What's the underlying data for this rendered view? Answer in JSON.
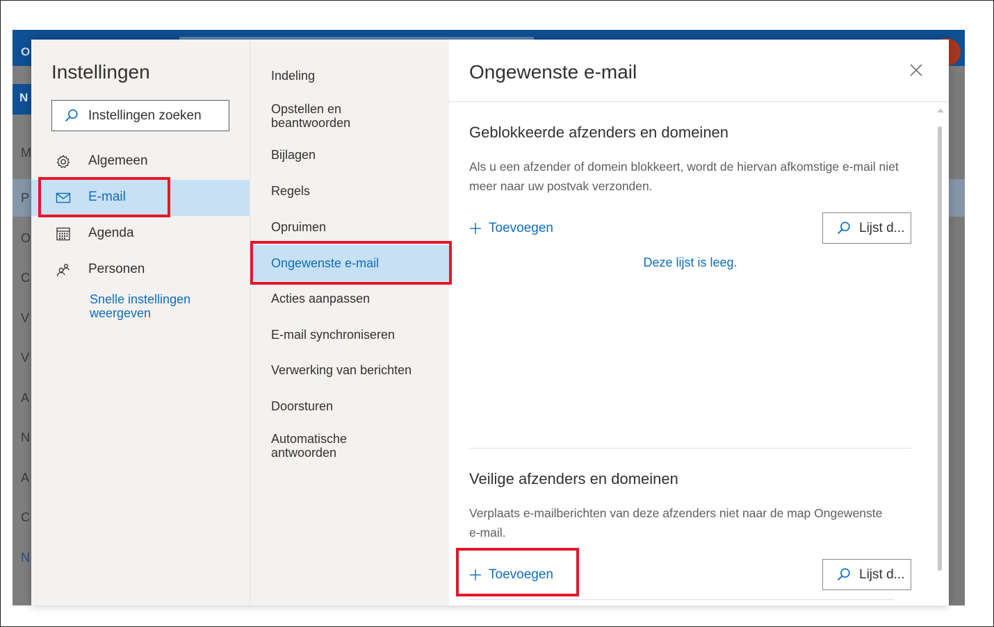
{
  "settings": {
    "title": "Instellingen",
    "search_placeholder": "Instellingen zoeken",
    "nav": [
      {
        "label": "Algemeen",
        "icon": "gear-icon"
      },
      {
        "label": "E-mail",
        "icon": "mail-icon"
      },
      {
        "label": "Agenda",
        "icon": "calendar-icon"
      },
      {
        "label": "Personen",
        "icon": "people-icon"
      }
    ],
    "quick_settings": "Snelle instellingen weergeven"
  },
  "mail_sub": {
    "items": [
      "Indeling",
      "Opstellen en beantwoorden",
      "Bijlagen",
      "Regels",
      "Opruimen",
      "Ongewenste e-mail",
      "Acties aanpassen",
      "E-mail synchroniseren",
      "Verwerking van berichten",
      "Doorsturen",
      "Automatische antwoorden"
    ]
  },
  "junk": {
    "title": "Ongewenste e-mail",
    "blocked": {
      "title": "Geblokkeerde afzenders en domeinen",
      "description": "Als u een afzender of domein blokkeert, wordt de hiervan afkomstige e-mail niet meer naar uw postvak verzonden.",
      "add_label": "Toevoegen",
      "search_placeholder": "Lijst d...",
      "empty": "Deze lijst is leeg."
    },
    "safe": {
      "title": "Veilige afzenders en domeinen",
      "description": "Verplaats e-mailberichten van deze afzenders niet naar de map Ongewenste e-mail.",
      "add_label": "Toevoegen",
      "search_placeholder": "Lijst d..."
    }
  },
  "colors": {
    "accent": "#0f6cbd",
    "selected": "#c7e0f4",
    "highlight": "#e5172a"
  }
}
